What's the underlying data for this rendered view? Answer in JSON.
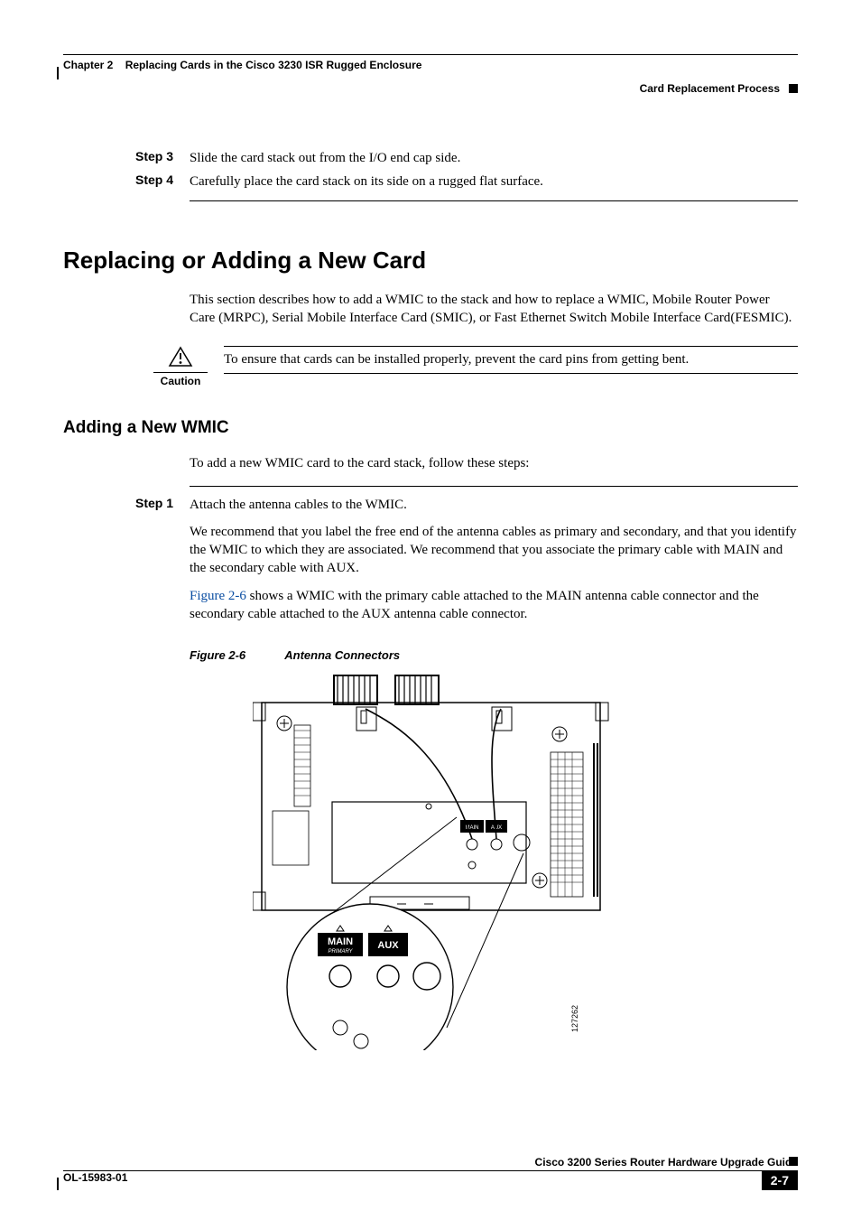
{
  "header": {
    "chapter": "Chapter 2",
    "chapter_title": "Replacing Cards in the Cisco 3230 ISR Rugged Enclosure",
    "section": "Card Replacement Process"
  },
  "steps_top": [
    {
      "label": "Step 3",
      "text": "Slide the card stack out from the I/O end cap side."
    },
    {
      "label": "Step 4",
      "text": "Carefully place the card stack on its side on a rugged flat surface."
    }
  ],
  "h1": "Replacing or Adding a New Card",
  "intro_para": "This section describes how to add a WMIC to the stack and how to replace a WMIC, Mobile Router Power Care (MRPC), Serial Mobile Interface Card (SMIC), or Fast Ethernet Switch Mobile Interface Card(FESMIC).",
  "caution": {
    "label": "Caution",
    "text": "To ensure that cards can be installed properly, prevent the card pins from getting bent."
  },
  "h2": "Adding a New WMIC",
  "h2_intro": "To add a new WMIC card to the card stack, follow these steps:",
  "step1": {
    "label": "Step 1",
    "line1": "Attach the antenna cables to the WMIC.",
    "para2": "We recommend that you label the free end of the antenna cables as primary and secondary, and that you identify the WMIC to which they are associated. We recommend that you associate the primary cable with MAIN and the secondary cable with AUX.",
    "para3_prefix": "Figure 2-6",
    "para3_rest": " shows a WMIC with the primary cable attached to the MAIN antenna cable connector and the secondary cable attached to the AUX antenna cable connector."
  },
  "figure": {
    "number": "Figure 2-6",
    "title": "Antenna Connectors",
    "labels": {
      "main": "MAIN",
      "aux": "AUX",
      "primary": "PRIMARY",
      "id": "127262"
    }
  },
  "footer": {
    "doc_id": "OL-15983-01",
    "book": "Cisco 3200 Series Router Hardware Upgrade Guide",
    "page": "2-7"
  }
}
